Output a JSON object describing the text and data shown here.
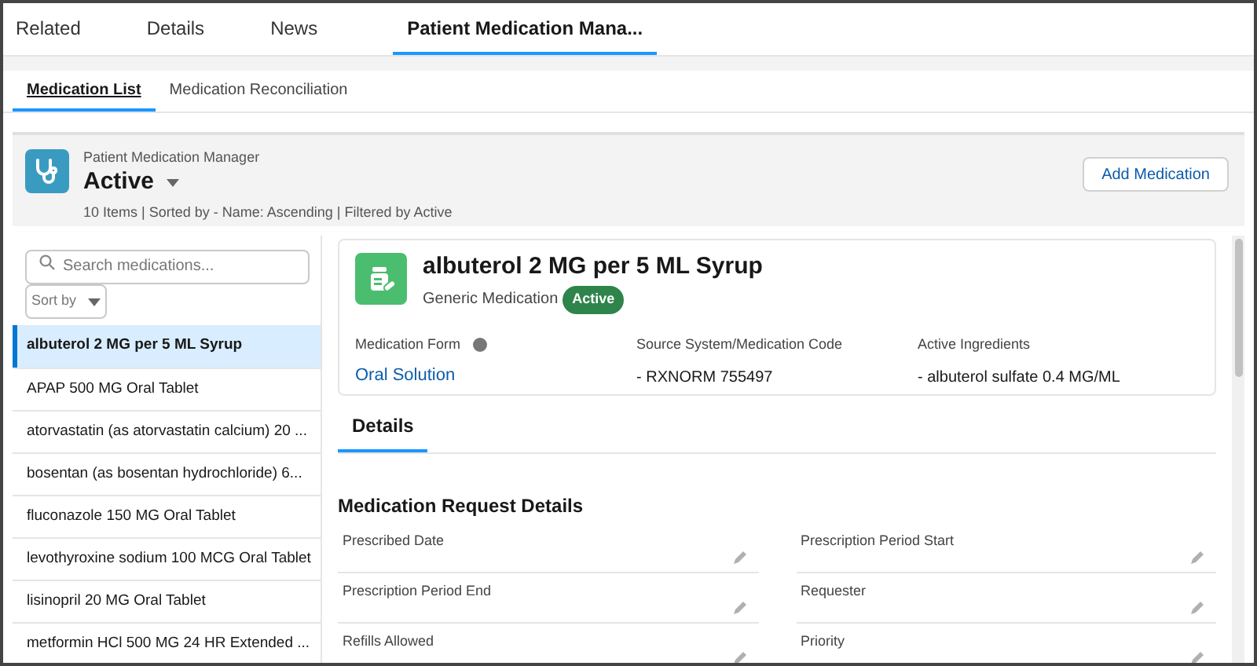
{
  "tabs": [
    {
      "label": "Related",
      "selected": false
    },
    {
      "label": "Details",
      "selected": false
    },
    {
      "label": "News",
      "selected": false
    },
    {
      "label": "Patient Medication Mana...",
      "selected": true
    }
  ],
  "subtabs": [
    {
      "label": "Medication List",
      "selected": true
    },
    {
      "label": "Medication Reconciliation",
      "selected": false
    }
  ],
  "header": {
    "app_name": "Patient Medication Manager",
    "list_view": "Active",
    "summary": "10 Items | Sorted by - Name: Ascending | Filtered by Active",
    "add_button": "Add Medication"
  },
  "search": {
    "placeholder": "Search medications..."
  },
  "sort": {
    "label": "Sort by"
  },
  "medications": [
    {
      "name": "albuterol 2 MG per 5 ML Syrup",
      "selected": true
    },
    {
      "name": "APAP 500 MG Oral Tablet",
      "selected": false
    },
    {
      "name": "atorvastatin (as atorvastatin calcium) 20 ...",
      "selected": false
    },
    {
      "name": "bosentan (as bosentan hydrochloride) 6...",
      "selected": false
    },
    {
      "name": "fluconazole 150 MG Oral Tablet",
      "selected": false
    },
    {
      "name": "levothyroxine sodium 100 MCG Oral Tablet",
      "selected": false
    },
    {
      "name": "lisinopril 20 MG Oral Tablet",
      "selected": false
    },
    {
      "name": "metformin HCl 500 MG 24 HR Extended ...",
      "selected": false
    }
  ],
  "detail": {
    "title": "albuterol 2 MG per 5 ML Syrup",
    "subtitle": "Generic Medication",
    "status": "Active",
    "fields": [
      {
        "label": "Medication Form",
        "value": "Oral Solution",
        "kind": "link"
      },
      {
        "label": "Source System/Medication Code",
        "value": "- RXNORM 755497",
        "kind": "text"
      },
      {
        "label": "Active Ingredients",
        "value": "- albuterol sulfate 0.4 MG/ML",
        "kind": "text"
      }
    ],
    "tab": "Details",
    "section": "Medication Request Details",
    "request_fields": [
      "Prescribed Date",
      "Prescription Period Start",
      "Prescription Period End",
      "Requester",
      "Refills Allowed",
      "Priority"
    ]
  }
}
